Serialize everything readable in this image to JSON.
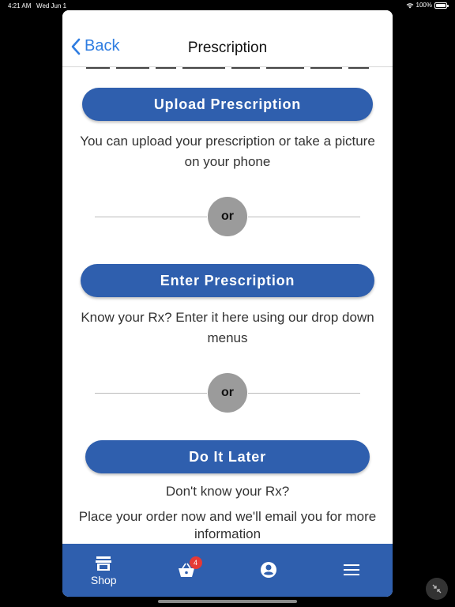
{
  "status_bar": {
    "time": "4:21 AM",
    "date": "Wed Jun 1",
    "battery": "100%"
  },
  "nav": {
    "back_label": "Back",
    "title": "Prescription"
  },
  "content": {
    "upload_button": "Upload Prescription",
    "upload_desc": "You can upload your prescription or take a picture on your phone",
    "or_label_1": "or",
    "enter_button": "Enter Prescription",
    "enter_desc": "Know your Rx? Enter it here using our drop down menus",
    "or_label_2": "or",
    "later_button": "Do It Later",
    "later_desc_1": "Don't know your Rx?",
    "later_desc_2": "Place your order now and we'll email you for more information"
  },
  "tabs": [
    {
      "label": "Shop",
      "icon": "shop-icon"
    },
    {
      "label": "",
      "icon": "basket-icon",
      "badge": "4"
    },
    {
      "label": "",
      "icon": "account-icon"
    },
    {
      "label": "",
      "icon": "menu-icon"
    }
  ],
  "colors": {
    "primary": "#2f5fae",
    "link": "#2f7de1",
    "badge": "#e53935",
    "divider_circle": "#9b9b9b"
  }
}
